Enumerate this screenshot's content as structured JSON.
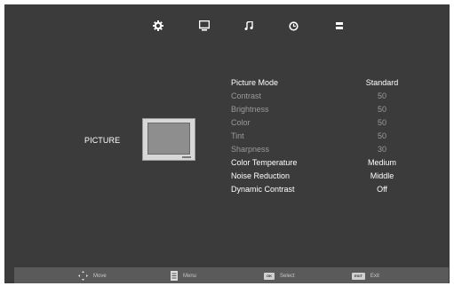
{
  "top_icons": [
    "settings-gear-icon",
    "picture-monitor-icon",
    "sound-note-icon",
    "time-clock-icon",
    "setup-list-icon"
  ],
  "section": {
    "label": "PICTURE"
  },
  "menu": {
    "items": [
      {
        "label": "Picture Mode",
        "value": "Standard",
        "state": "active"
      },
      {
        "label": "Contrast",
        "value": "50",
        "state": "dim"
      },
      {
        "label": "Brightness",
        "value": "50",
        "state": "dim"
      },
      {
        "label": "Color",
        "value": "50",
        "state": "dim"
      },
      {
        "label": "Tint",
        "value": "50",
        "state": "dim"
      },
      {
        "label": "Sharpness",
        "value": "30",
        "state": "dim"
      },
      {
        "label": "Color Temperature",
        "value": "Medium",
        "state": "active"
      },
      {
        "label": "Noise Reduction",
        "value": "Middle",
        "state": "active"
      },
      {
        "label": "Dynamic Contrast",
        "value": "Off",
        "state": "active"
      }
    ]
  },
  "footer": {
    "move": "Move",
    "menu": "Menu",
    "ok_key": "OK",
    "select": "Select",
    "exit_key": "EXIT",
    "exit": "Exit"
  },
  "colors": {
    "background": "#3b3b3b",
    "footer": "#5a5a5a",
    "active_text": "#ffffff",
    "dim_text": "#9a9a9a"
  }
}
